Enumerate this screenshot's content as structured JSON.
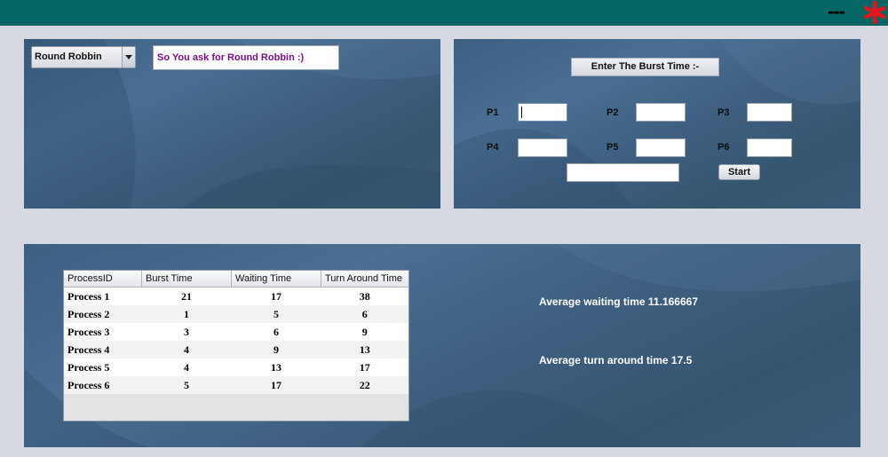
{
  "window": {
    "minimize_label": "---"
  },
  "algorithm_panel": {
    "selected_algorithm": "Round Robbin",
    "message": "So You ask for Round Robbin :)"
  },
  "burst_panel": {
    "header": "Enter The Burst Time :-",
    "process_labels": [
      "P1",
      "P2",
      "P3",
      "P4",
      "P5",
      "P6"
    ],
    "start_label": "Start"
  },
  "results": {
    "columns": [
      "ProcessID",
      "Burst Time",
      "Waiting Time",
      "Turn Around Time"
    ],
    "rows": [
      {
        "process": "Process 1",
        "burst": "21",
        "waiting": "17",
        "turnaround": "38"
      },
      {
        "process": "Process 2",
        "burst": "1",
        "waiting": "5",
        "turnaround": "6"
      },
      {
        "process": "Process 3",
        "burst": "3",
        "waiting": "6",
        "turnaround": "9"
      },
      {
        "process": "Process 4",
        "burst": "4",
        "waiting": "9",
        "turnaround": "13"
      },
      {
        "process": "Process 5",
        "burst": "4",
        "waiting": "13",
        "turnaround": "17"
      },
      {
        "process": "Process 6",
        "burst": "5",
        "waiting": "17",
        "turnaround": "22"
      }
    ],
    "avg_waiting": "Average waiting time 11.166667",
    "avg_turnaround": "Average turn around time 17.5"
  },
  "colors": {
    "title_bar": "#036765",
    "close_star": "#e8141c",
    "message_text": "#7b0f8a"
  },
  "icons": {
    "close": "star-icon",
    "dropdown": "chevron-down-icon"
  }
}
